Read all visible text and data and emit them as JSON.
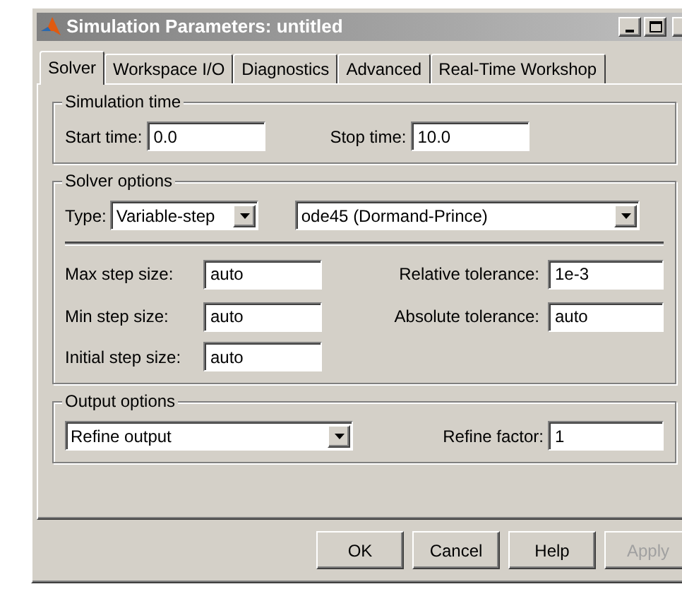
{
  "window": {
    "title": "Simulation Parameters: untitled"
  },
  "tabs": [
    {
      "label": "Solver",
      "selected": true
    },
    {
      "label": "Workspace I/O",
      "selected": false
    },
    {
      "label": "Diagnostics",
      "selected": false
    },
    {
      "label": "Advanced",
      "selected": false
    },
    {
      "label": "Real-Time Workshop",
      "selected": false
    }
  ],
  "simulation_time": {
    "title": "Simulation time",
    "start_label": "Start time:",
    "start_value": "0.0",
    "stop_label": "Stop time:",
    "stop_value": "10.0"
  },
  "solver_options": {
    "title": "Solver options",
    "type_label": "Type:",
    "type_value": "Variable-step",
    "solver_value": "ode45 (Dormand-Prince)",
    "max_step_label": "Max step size:",
    "max_step_value": "auto",
    "min_step_label": "Min step size:",
    "min_step_value": "auto",
    "initial_step_label": "Initial step size:",
    "initial_step_value": "auto",
    "rel_tol_label": "Relative tolerance:",
    "rel_tol_value": "1e-3",
    "abs_tol_label": "Absolute tolerance:",
    "abs_tol_value": "auto"
  },
  "output_options": {
    "title": "Output options",
    "mode_value": "Refine output",
    "refine_label": "Refine factor:",
    "refine_value": "1"
  },
  "buttons": [
    {
      "label": "OK",
      "disabled": false
    },
    {
      "label": "Cancel",
      "disabled": false
    },
    {
      "label": "Help",
      "disabled": false
    },
    {
      "label": "Apply",
      "disabled": true
    }
  ]
}
